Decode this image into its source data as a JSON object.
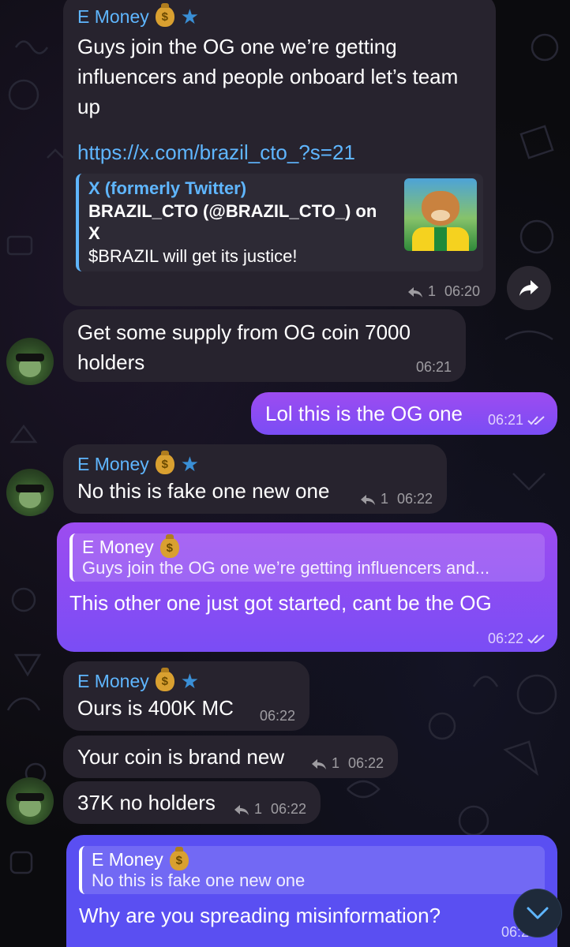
{
  "messages": {
    "m1": {
      "sender": "E Money",
      "text": "Guys join the OG one we’re getting influencers and people onboard let’s team up",
      "link": "https://x.com/brazil_cto_?s=21",
      "preview": {
        "site": "X (formerly Twitter)",
        "title": "BRAZIL_CTO (@BRAZIL_CTO_) on X",
        "description": "$BRAZIL will get its justice!"
      },
      "replies": "1",
      "time": "06:20"
    },
    "m2": {
      "text": "Get some supply from OG coin 7000 holders",
      "time": "06:21"
    },
    "m3": {
      "text": "Lol this is the OG one",
      "time": "06:21"
    },
    "m4": {
      "sender": "E Money",
      "text": "No this is fake one new one",
      "replies": "1",
      "time": "06:22"
    },
    "m5": {
      "quote_name": "E Money",
      "quote_text": "Guys join the OG one we’re getting influencers and...",
      "text": "This other one just got started, cant be the OG",
      "time": "06:22"
    },
    "m6": {
      "sender": "E Money",
      "text": "Ours is 400K MC",
      "time": "06:22"
    },
    "m7": {
      "text": "Your coin is brand new",
      "replies": "1",
      "time": "06:22"
    },
    "m8": {
      "text": "37K no holders",
      "replies": "1",
      "time": "06:22"
    },
    "m9": {
      "quote_name": "E Money",
      "quote_text": "No this is fake one new one",
      "text": "Why are you spreading misinformation?",
      "time": "06:2"
    }
  },
  "colors": {
    "incoming_bubble": "#27232e",
    "outgoing_bubble": "#8a4cf2",
    "accent": "#5fb6ff"
  },
  "icons": [
    "money-bag-icon",
    "star-icon",
    "reply-icon",
    "double-check-icon",
    "forward-icon",
    "chevron-down-icon"
  ]
}
